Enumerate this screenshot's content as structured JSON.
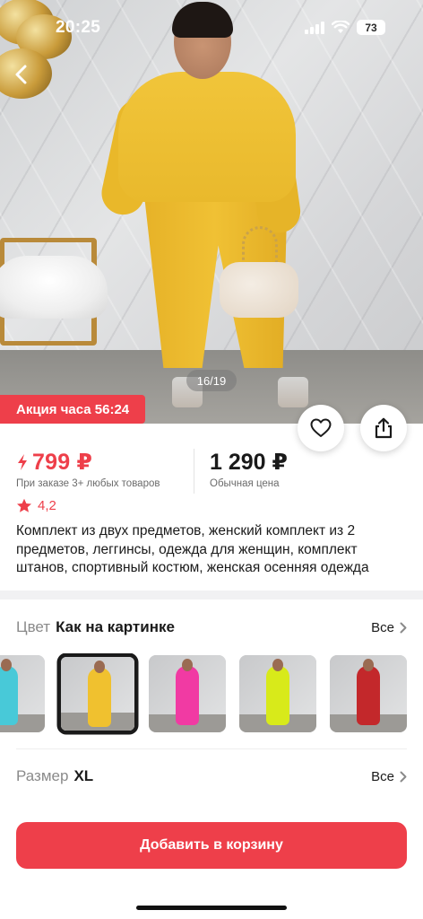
{
  "status_bar": {
    "time": "20:25",
    "battery": "73",
    "icons": [
      "signal-icon",
      "wifi-icon",
      "battery-icon"
    ]
  },
  "gallery": {
    "counter": "16/19",
    "promo": "Акция часа 56:24"
  },
  "actions": {
    "back_icon": "chevron-left-icon",
    "favorite_icon": "heart-icon",
    "share_icon": "share-icon"
  },
  "price": {
    "sale_value": "799 ₽",
    "sale_note": "При заказе 3+ любых товаров",
    "regular_value": "1 290 ₽",
    "regular_note": "Обычная цена"
  },
  "rating": {
    "value": "4,2"
  },
  "product": {
    "title": "Комплект из двух предметов, женский комплект из 2 предметов, леггинсы, одежда для женщин, комплект штанов, спортивный костюм, женская осенняя одежда"
  },
  "color": {
    "label": "Цвет",
    "value": "Как на картинке",
    "all_label": "Все",
    "swatches": [
      {
        "color": "#48c9d8",
        "selected": false
      },
      {
        "color": "#f0c12f",
        "selected": true
      },
      {
        "color": "#f13aa3",
        "selected": false
      },
      {
        "color": "#d8ea1a",
        "selected": false
      },
      {
        "color": "#c3282b",
        "selected": false
      }
    ]
  },
  "size": {
    "label": "Размер",
    "value": "XL",
    "all_label": "Все"
  },
  "cta": {
    "label": "Добавить в корзину"
  },
  "colors": {
    "accent": "#ee3f4a",
    "text": "#1a1a1a",
    "muted": "#8a8a8a"
  }
}
